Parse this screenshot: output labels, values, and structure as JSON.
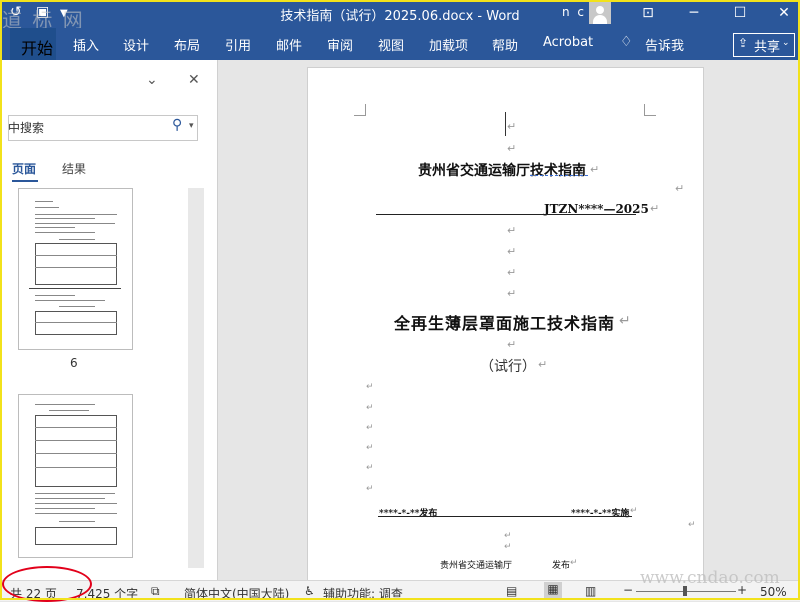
{
  "window": {
    "title": "技术指南（试行）2025.06.docx  -  Word",
    "user_initials": "n c",
    "watermark_top": "道 标 网"
  },
  "ribbon": {
    "tabs": [
      "开始",
      "插入",
      "设计",
      "布局",
      "引用",
      "邮件",
      "审阅",
      "视图",
      "加载项",
      "帮助",
      "Acrobat"
    ],
    "tell_me": "告诉我",
    "share": "共享"
  },
  "nav_pane": {
    "search_placeholder": "中搜索",
    "tab_pages": "页面",
    "tab_results": "结果",
    "thumb_page_number": "6"
  },
  "document": {
    "dept_title": "贵州省交通运输厅技术指南",
    "code": "JTZN****—2025",
    "main_title": "全再生薄层罩面施工技术指南",
    "subtitle": "（试行）",
    "publish_date": "****-*-**发布",
    "effective_date": "****-*-**实施",
    "issuer": "贵州省交通运输厅",
    "issue_word": "发布",
    "para_mark": "↵"
  },
  "status": {
    "page_count": "共 22 页",
    "word_count": "7,425 个字",
    "language": "简体中文(中国大陆)",
    "accessibility": "辅助功能: 调查",
    "zoom": "50%",
    "watermark": "www.cndao.com"
  },
  "colors": {
    "accent": "#2b579a",
    "highlight_circle": "#e2001a",
    "frame": "#f2e21b"
  }
}
